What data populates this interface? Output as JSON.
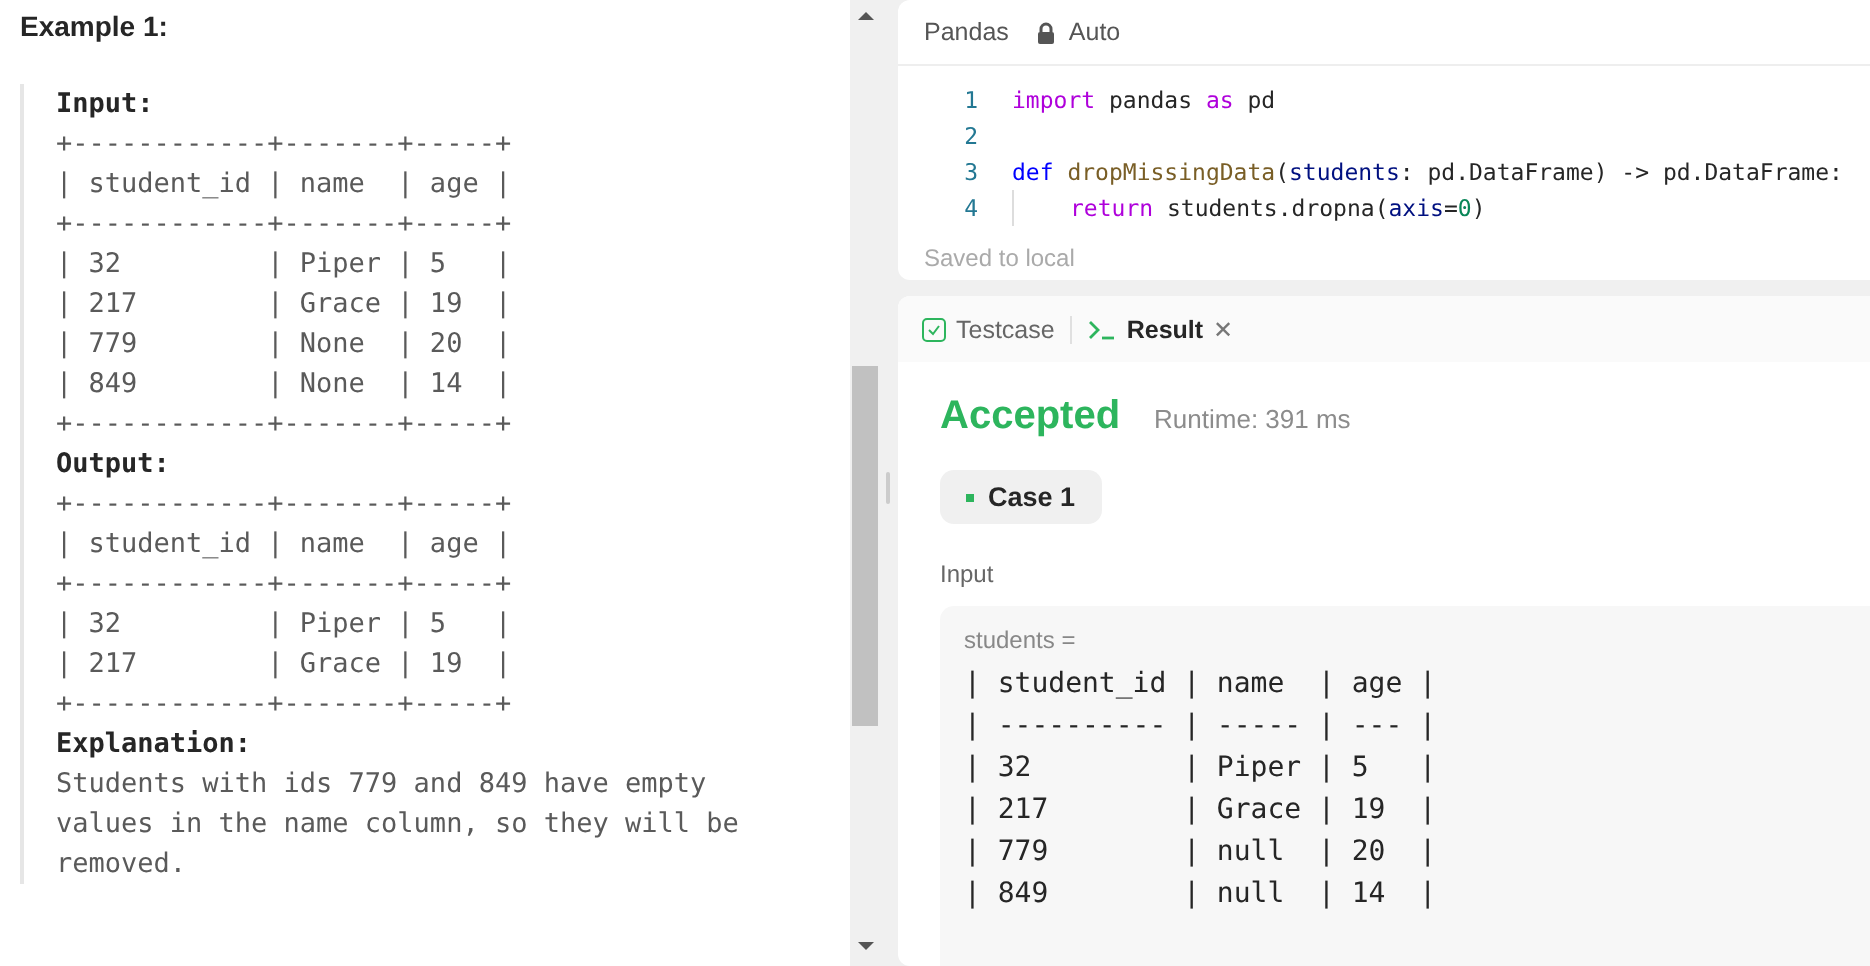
{
  "description": {
    "heading": "Example 1:",
    "blocks": [
      {
        "label": "Input:",
        "lines": [
          "+------------+-------+-----+",
          "| student_id | name  | age |",
          "+------------+-------+-----+",
          "| 32         | Piper | 5   |",
          "| 217        | Grace | 19  |",
          "| 779        | None  | 20  |",
          "| 849        | None  | 14  |",
          "+------------+-------+-----+"
        ]
      },
      {
        "label": "Output:",
        "lines": [
          "+------------+-------+-----+",
          "| student_id | name  | age |",
          "+------------+-------+-----+",
          "| 32         | Piper | 5   |",
          "| 217        | Grace | 19  |",
          "+------------+-------+-----+"
        ]
      },
      {
        "label": "Explanation:",
        "text": "Students with ids 779 and 849 have empty values in the name column, so they will be removed."
      }
    ]
  },
  "editor": {
    "language": "Pandas",
    "mode": "Auto",
    "lines": [
      {
        "number": "1",
        "tokens": [
          {
            "text": "import",
            "kind": "keyword"
          },
          {
            "text": " pandas ",
            "kind": "plain"
          },
          {
            "text": "as",
            "kind": "keyword"
          },
          {
            "text": " pd",
            "kind": "plain"
          }
        ]
      },
      {
        "number": "2"
      },
      {
        "number": "3",
        "tokens": [
          {
            "text": "def ",
            "kind": "def"
          },
          {
            "text": "dropMissingData",
            "kind": "func"
          },
          {
            "text": "(",
            "kind": "plain"
          },
          {
            "text": "students",
            "kind": "param"
          },
          {
            "text": ": pd.DataFrame) -> pd.DataFrame:",
            "kind": "plain"
          }
        ]
      },
      {
        "number": "4",
        "indented": true,
        "tokens": [
          {
            "text": "return",
            "kind": "keyword"
          },
          {
            "text": " students.dropna(",
            "kind": "plain"
          },
          {
            "text": "axis",
            "kind": "param"
          },
          {
            "text": "=",
            "kind": "plain"
          },
          {
            "text": "0",
            "kind": "number"
          },
          {
            "text": ")",
            "kind": "plain"
          }
        ]
      }
    ],
    "status": "Saved to local"
  },
  "results": {
    "tabs": [
      {
        "label": "Testcase",
        "selected": false
      },
      {
        "label": "Result",
        "selected": true,
        "close": "✕"
      }
    ],
    "verdict": "Accepted",
    "runtime": "Runtime: 391 ms",
    "cases": [
      {
        "label": "Case 1",
        "selected": true
      }
    ],
    "input_label": "Input",
    "variable": "students =",
    "lines": [
      "| student_id | name  | age |",
      "| ---------- | ----- | --- |",
      "| 32         | Piper | 5   |",
      "| 217        | Grace | 19  |",
      "| 779        | null  | 20  |",
      "| 849        | null  | 14  |"
    ]
  }
}
